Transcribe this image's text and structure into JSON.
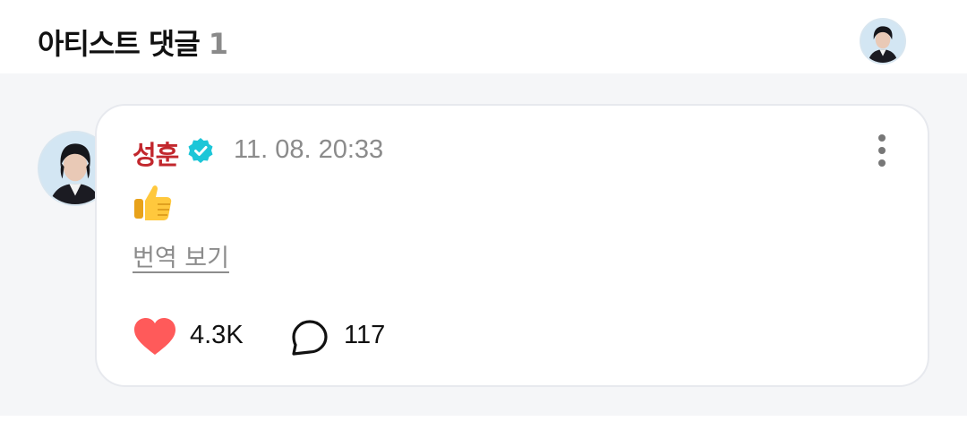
{
  "header": {
    "title": "아티스트 댓글",
    "count": "1",
    "avatar_icon": "artist-avatar-icon"
  },
  "comment": {
    "author": "성훈",
    "verified_icon": "verified-badge-icon",
    "timestamp": "11. 08. 20:33",
    "body_emoji": "thumbs-up-emoji",
    "translate_label": "번역 보기",
    "likes": "4.3K",
    "replies": "117",
    "more_icon": "more-vertical-icon",
    "heart_icon": "heart-icon",
    "reply_icon": "comment-bubble-icon"
  },
  "colors": {
    "author": "#c2272d",
    "heart": "#ff5a5a",
    "verified": "#1cc6d8",
    "background": "#f5f6f8"
  }
}
